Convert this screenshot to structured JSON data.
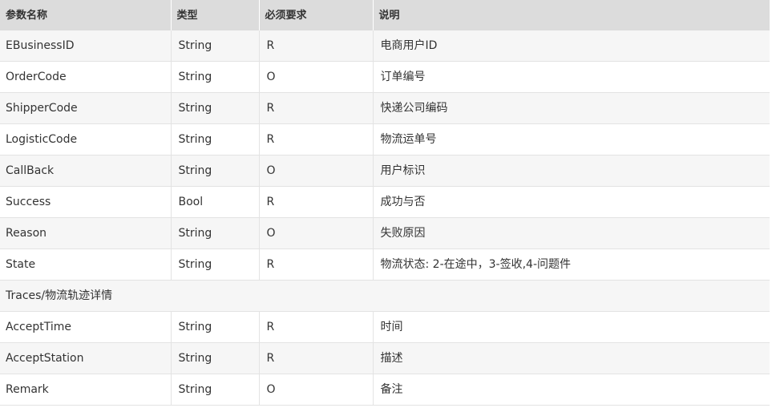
{
  "table": {
    "headers": [
      "参数名称",
      "类型",
      "必须要求",
      "说明"
    ],
    "rows_before_section": [
      {
        "name": "EBusinessID",
        "type": "String",
        "required": "R",
        "desc": "电商用户ID"
      },
      {
        "name": "OrderCode",
        "type": "String",
        "required": "O",
        "desc": "订单编号"
      },
      {
        "name": "ShipperCode",
        "type": "String",
        "required": "R",
        "desc": "快递公司编码"
      },
      {
        "name": "LogisticCode",
        "type": "String",
        "required": "R",
        "desc": "物流运单号"
      },
      {
        "name": "CallBack",
        "type": "String",
        "required": "O",
        "desc": "用户标识"
      },
      {
        "name": "Success",
        "type": "Bool",
        "required": "R",
        "desc": "成功与否"
      },
      {
        "name": "Reason",
        "type": "String",
        "required": "O",
        "desc": "失败原因"
      },
      {
        "name": "State",
        "type": "String",
        "required": "R",
        "desc": "物流状态: 2-在途中，3-签收,4-问题件"
      }
    ],
    "section_label": "Traces/物流轨迹详情",
    "rows_after_section": [
      {
        "name": "AcceptTime",
        "type": "String",
        "required": "R",
        "desc": "时间"
      },
      {
        "name": "AcceptStation",
        "type": "String",
        "required": "R",
        "desc": "描述"
      },
      {
        "name": "Remark",
        "type": "String",
        "required": "O",
        "desc": "备注"
      }
    ]
  }
}
